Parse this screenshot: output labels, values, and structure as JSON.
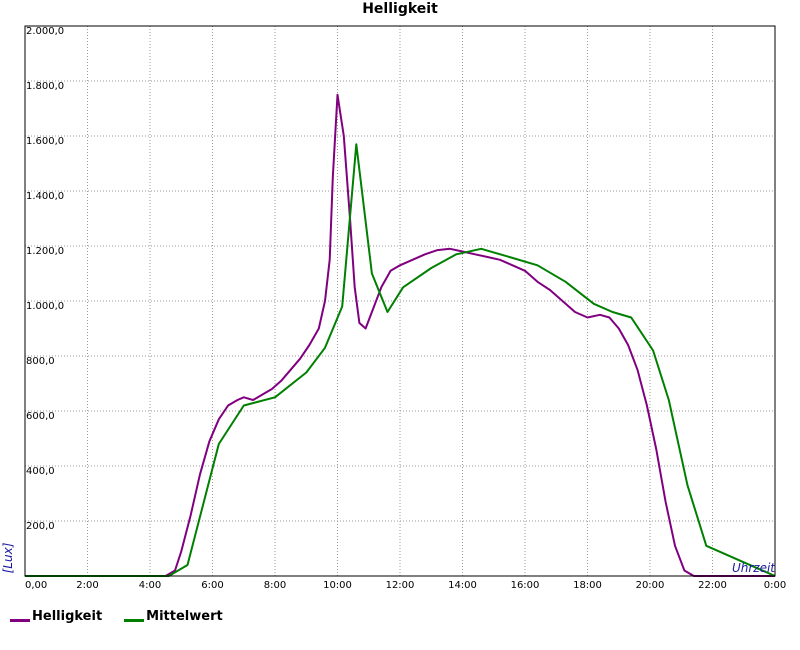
{
  "chart_data": {
    "type": "line",
    "title": "Helligkeit",
    "xlabel": "Uhrzeit",
    "ylabel": "[Lux]",
    "xlim": [
      0,
      24
    ],
    "ylim": [
      0,
      2000
    ],
    "grid": true,
    "legend_position": "bottom-left",
    "x_tick_labels": [
      "0,00",
      "2:00",
      "4:00",
      "6:00",
      "8:00",
      "10:00",
      "12:00",
      "14:00",
      "16:00",
      "18:00",
      "20:00",
      "22:00",
      "0:00"
    ],
    "y_tick_labels": [
      "",
      "200,0",
      "400,0",
      "600,0",
      "800,0",
      "1.000,0",
      "1.200,0",
      "1.400,0",
      "1.600,0",
      "1.800,0",
      "2.000,0"
    ],
    "series": [
      {
        "name": "Helligkeit",
        "color": "#800080",
        "x": [
          0,
          4.5,
          4.8,
          5.0,
          5.3,
          5.6,
          5.9,
          6.2,
          6.5,
          6.8,
          7.0,
          7.3,
          7.6,
          7.9,
          8.2,
          8.5,
          8.8,
          9.1,
          9.4,
          9.6,
          9.75,
          9.85,
          10.0,
          10.2,
          10.4,
          10.55,
          10.7,
          10.9,
          11.1,
          11.4,
          11.7,
          12.0,
          12.4,
          12.8,
          13.2,
          13.6,
          14.0,
          14.4,
          14.8,
          15.2,
          15.6,
          16.0,
          16.4,
          16.8,
          17.2,
          17.6,
          18.0,
          18.4,
          18.7,
          19.0,
          19.3,
          19.6,
          19.9,
          20.2,
          20.5,
          20.8,
          21.1,
          21.4,
          21.7,
          24
        ],
        "y": [
          0,
          0,
          20,
          90,
          220,
          370,
          490,
          570,
          620,
          640,
          650,
          640,
          660,
          680,
          710,
          750,
          790,
          840,
          900,
          1000,
          1150,
          1450,
          1750,
          1600,
          1300,
          1050,
          920,
          900,
          960,
          1050,
          1110,
          1130,
          1150,
          1170,
          1185,
          1190,
          1180,
          1170,
          1160,
          1150,
          1130,
          1110,
          1070,
          1040,
          1000,
          960,
          940,
          950,
          940,
          900,
          840,
          750,
          620,
          460,
          270,
          110,
          20,
          0,
          0,
          0
        ]
      },
      {
        "name": "Mittelwert",
        "color": "#008000",
        "x": [
          0,
          4.6,
          5.2,
          6.2,
          7.0,
          8.0,
          9.0,
          9.6,
          10.15,
          10.6,
          11.1,
          11.6,
          12.1,
          13.0,
          13.8,
          14.6,
          15.5,
          16.4,
          17.3,
          18.2,
          18.8,
          19.4,
          20.1,
          20.6,
          21.2,
          21.8,
          24
        ],
        "y": [
          0,
          0,
          40,
          480,
          620,
          650,
          740,
          830,
          980,
          1570,
          1100,
          960,
          1050,
          1120,
          1170,
          1190,
          1160,
          1130,
          1070,
          990,
          960,
          940,
          820,
          640,
          330,
          110,
          0
        ]
      }
    ]
  }
}
